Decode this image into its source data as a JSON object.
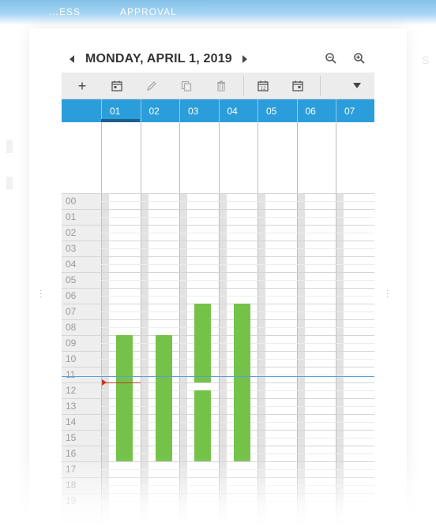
{
  "nav": {
    "item1": "…ESS",
    "item2": "APPROVAL"
  },
  "header": {
    "date": "MONDAY, APRIL 1, 2019"
  },
  "toolbar": {
    "add": "+",
    "buttons": [
      "add-icon",
      "calendar-icon",
      "pencil-icon",
      "copy-icon",
      "trash-icon",
      "calendar-12-icon",
      "calendar-check-icon",
      "dropdown-icon"
    ]
  },
  "days": [
    "01",
    "02",
    "03",
    "04",
    "05",
    "06",
    "07"
  ],
  "hours": [
    "00",
    "01",
    "02",
    "03",
    "04",
    "05",
    "06",
    "07",
    "08",
    "09",
    "10",
    "11",
    "12",
    "13",
    "14",
    "15",
    "16",
    "17",
    "18",
    "19"
  ],
  "events": [
    {
      "day": "01",
      "start": "09:00",
      "end": "17:00"
    },
    {
      "day": "02",
      "start": "09:00",
      "end": "17:00"
    },
    {
      "day": "03",
      "start": "07:00",
      "end": "12:00"
    },
    {
      "day": "03",
      "start": "12:30",
      "end": "17:00"
    },
    {
      "day": "04",
      "start": "07:00",
      "end": "17:00"
    }
  ],
  "now": {
    "time": "12:00",
    "day": "01"
  },
  "colors": {
    "accent": "#2b9ddb",
    "event": "#74c24a",
    "now_marker": "#c0392b"
  }
}
